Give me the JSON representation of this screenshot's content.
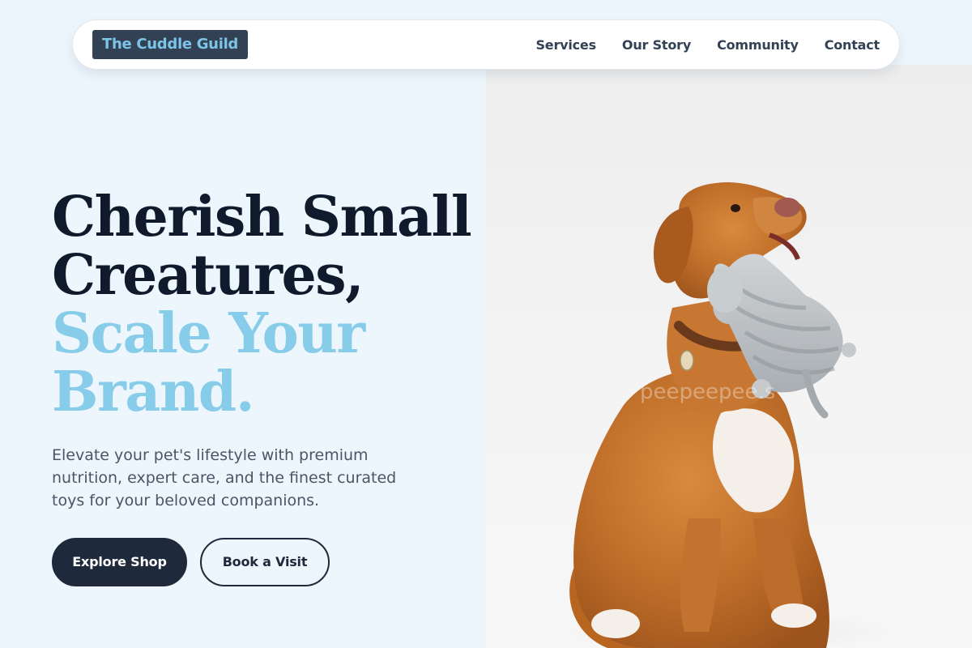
{
  "header": {
    "brand": "The Cuddle Guild",
    "nav": [
      {
        "label": "Services"
      },
      {
        "label": "Our Story"
      },
      {
        "label": "Community"
      },
      {
        "label": "Contact"
      }
    ]
  },
  "hero": {
    "headline_line1": "Cherish Small",
    "headline_line2": "Creatures,",
    "headline_accent_line1": "Scale Your",
    "headline_accent_line2": "Brand.",
    "subtext": "Elevate your pet's lifestyle with premium nutrition, expert care, and the finest curated toys for your beloved companions.",
    "primary_cta": "Explore Shop",
    "secondary_cta": "Book a Visit",
    "image_subject": "dog-with-plush-elephant-toy",
    "image_watermark": "peepeepee.s"
  },
  "colors": {
    "page_background": "#eef6fd",
    "navy": "#1e293b",
    "headline_dark": "#0f1b2d",
    "accent_blue": "#87cdea",
    "brand_badge": "#334155",
    "body_text": "#4a5565"
  }
}
